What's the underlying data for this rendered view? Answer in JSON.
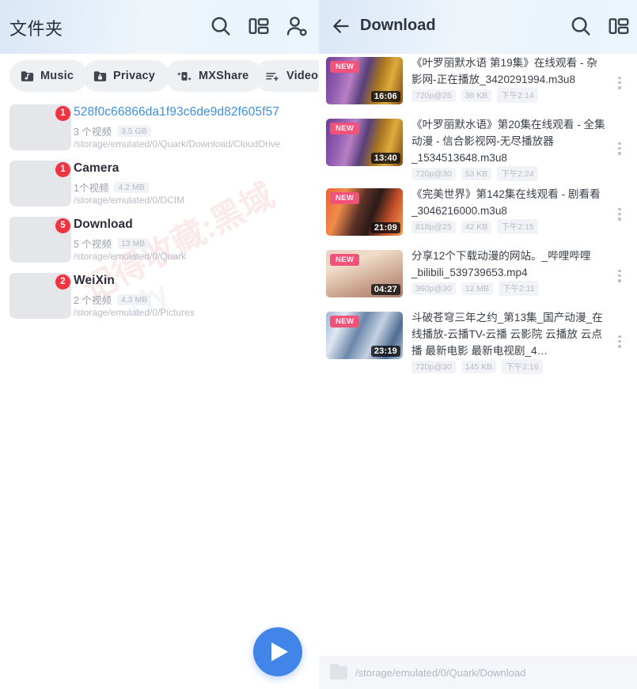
{
  "theme": {
    "accent": "#4285e8",
    "badge_red": "#ef3340",
    "new_badge": "#f2527a",
    "selected_blue": "#3e8fe0"
  },
  "left": {
    "title": "文件夹",
    "icons": {
      "search": "search-icon",
      "grid": "grid-view-icon",
      "user": "account-icon"
    },
    "chips": [
      {
        "label": "Music",
        "icon": "folder-music-icon"
      },
      {
        "label": "Privacy",
        "icon": "folder-lock-icon"
      },
      {
        "label": "MXShare",
        "icon": "share-icon"
      },
      {
        "label": "Video",
        "icon": "playlist-add-icon"
      }
    ],
    "folders": [
      {
        "name": "528f0c66866da1f93c6de9d82f605f57",
        "badge": "1",
        "count": "3 个视频",
        "size": "3.5 GB",
        "path": "/storage/emulated/0/Quark/Download/CloudDrive",
        "selected": true
      },
      {
        "name": "Camera",
        "badge": "1",
        "count": "1个视频",
        "size": "4.2 MB",
        "path": "/storage/emulated/0/DCIM",
        "selected": false
      },
      {
        "name": "Download",
        "badge": "5",
        "count": "5 个视频",
        "size": "13 MB",
        "path": "/storage/emulated/0/Quark",
        "selected": false
      },
      {
        "name": "WeiXin",
        "badge": "2",
        "count": "2 个视频",
        "size": "4.3 MB",
        "path": "/storage/emulated/0/Pictures",
        "selected": false
      }
    ],
    "watermark_line1": "记得收藏:黑域",
    "watermark_line2": "Hy",
    "play_button": "play-icon"
  },
  "right": {
    "back": "back-arrow-icon",
    "title": "Download",
    "icons": {
      "search": "search-icon",
      "grid": "grid-view-icon"
    },
    "path_bar": {
      "icon": "folder-icon",
      "text": "/storage/emulated/0/Quark/Download"
    },
    "videos": [
      {
        "title": "《叶罗丽默水语 第19集》在线观看 - 杂影网-正在播放_3420291994.m3u8",
        "duration": "16:06",
        "new": "NEW",
        "resolution": "720p@25",
        "size": "36 KB",
        "time": "下午2:14",
        "lines": 2,
        "thumb": "anime-purple-gold"
      },
      {
        "title": "《叶罗丽默水语》第20集在线观看 - 全集动漫 - 信合影视网-无尽播放器_1534513648.m3u8",
        "duration": "13:40",
        "new": "NEW",
        "resolution": "720p@30",
        "size": "53 KB",
        "time": "下午2:24",
        "lines": 3,
        "thumb": "anime-purple-gold"
      },
      {
        "title": "《完美世界》第142集在线观看 - 剧看看_3046216000.m3u8",
        "duration": "21:09",
        "new": "NEW",
        "resolution": "818p@25",
        "size": "42 KB",
        "time": "下午2:15",
        "lines": 2,
        "thumb": "fire-orange"
      },
      {
        "title": "分享12个下载动漫的网站。_哔哩哔哩_bilibili_539739653.mp4",
        "duration": "04:27",
        "new": "NEW",
        "resolution": "360p@30",
        "size": "12 MB",
        "time": "下午2:11",
        "lines": 2,
        "thumb": "landscape-sepia"
      },
      {
        "title": "斗破苍穹三年之约_第13集_国产动漫_在线播放-云播TV-云播 云影院 云播放 云点播 最新电影 最新电视剧_4…",
        "duration": "23:19",
        "new": "NEW",
        "resolution": "720p@30",
        "size": "145 KB",
        "time": "下午2:16",
        "lines": 3,
        "thumb": "blue-scene"
      }
    ]
  }
}
